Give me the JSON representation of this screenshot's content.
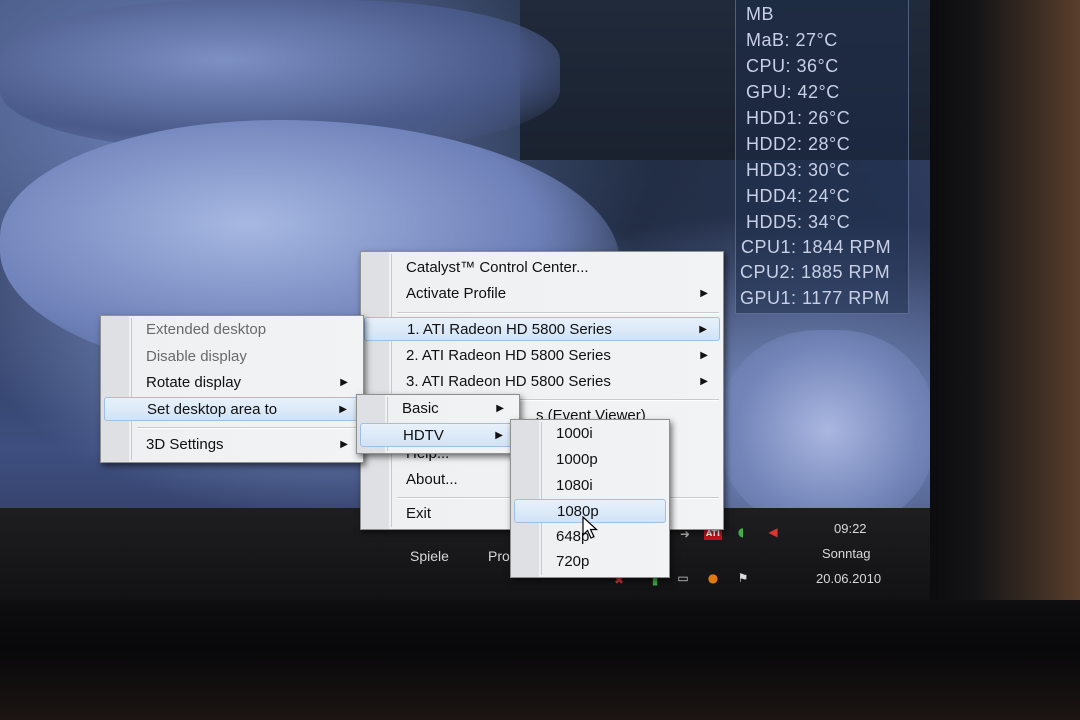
{
  "gadget": {
    "lines": [
      "MB",
      "MaB: 27°C",
      "CPU: 36°C",
      "GPU: 42°C",
      "HDD1: 26°C",
      "HDD2: 28°C",
      "HDD3: 30°C",
      "HDD4: 24°C",
      "HDD5: 34°C",
      "CPU1: 1844 RPM",
      "CPU2: 1885 RPM",
      "GPU1: 1177 RPM"
    ]
  },
  "main_menu": {
    "items": [
      {
        "label": "Catalyst™ Control Center...",
        "arrow": ""
      },
      {
        "label": "Activate Profile",
        "arrow": "▶"
      },
      {
        "label": "1. ATI Radeon HD 5800 Series",
        "arrow": "▶"
      },
      {
        "label": "2. ATI Radeon HD 5800 Series",
        "arrow": "▶"
      },
      {
        "label": "3. ATI Radeon HD 5800 Series",
        "arrow": "▶"
      },
      {
        "label": "s (Event Viewer)",
        "arrow": ""
      },
      {
        "label": "Help...",
        "arrow": ""
      },
      {
        "label": "About...",
        "arrow": ""
      },
      {
        "label": "Exit",
        "arrow": ""
      }
    ]
  },
  "display_menu": {
    "items": [
      {
        "label": "Extended desktop",
        "arrow": ""
      },
      {
        "label": "Disable display",
        "arrow": ""
      },
      {
        "label": "Rotate display",
        "arrow": "▶"
      },
      {
        "label": "Set desktop area to",
        "arrow": "▶"
      },
      {
        "label": "3D Settings",
        "arrow": "▶"
      }
    ]
  },
  "area_menu": {
    "items": [
      {
        "label": "Basic",
        "arrow": "▶"
      },
      {
        "label": "HDTV",
        "arrow": "▶"
      }
    ]
  },
  "hdtv_menu": {
    "items": [
      {
        "label": "1000i"
      },
      {
        "label": "1000p"
      },
      {
        "label": "1080i"
      },
      {
        "label": "1080p"
      },
      {
        "label": "648p"
      },
      {
        "label": "720p"
      }
    ]
  },
  "taskbar": {
    "items": [
      "Spiele",
      "Pro"
    ],
    "clock": {
      "time": "09:22",
      "day": "Sonntag",
      "date": "20.06.2010"
    },
    "tray_ati": "ATI"
  },
  "colors": {
    "highlight": "#d2e3f6",
    "menu_bg": "#f2f3f5",
    "gadget_text": "#c7d0e6"
  }
}
